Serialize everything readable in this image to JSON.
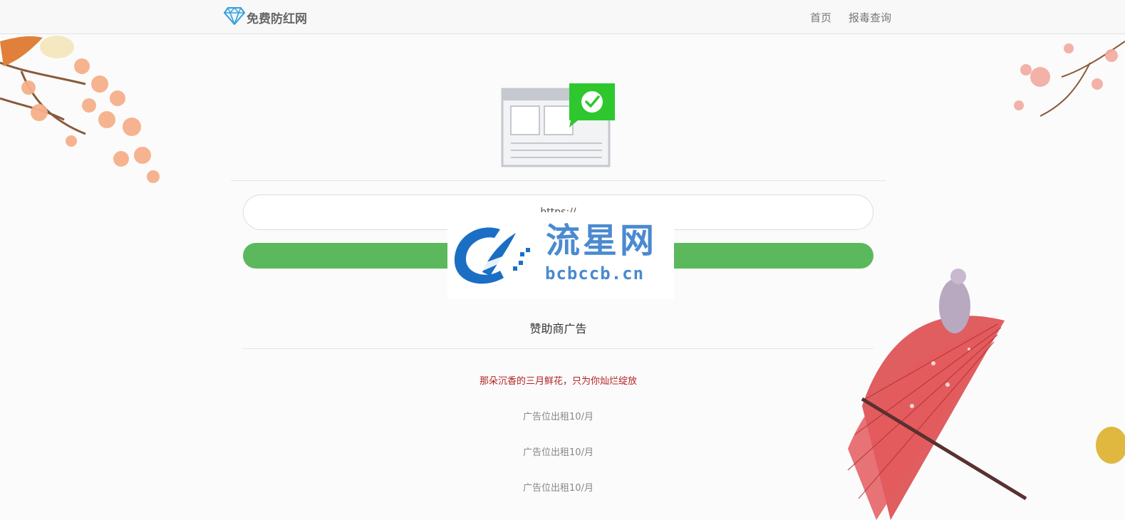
{
  "navbar": {
    "brand": "免费防红网",
    "links": [
      "首页",
      "报毒查询"
    ]
  },
  "form": {
    "url_placeholder": "https://",
    "url_value": "https://",
    "submit_label": ""
  },
  "watermark": {
    "title": "流星网",
    "domain": "bcbccb.cn"
  },
  "sponsor": {
    "title": "赞助商广告",
    "ads": [
      "那朵沉香的三月鲜花，只为你灿烂绽放",
      "广告位出租10/月",
      "广告位出租10/月",
      "广告位出租10/月"
    ]
  },
  "colors": {
    "accent_green": "#5cb85c",
    "ad_red": "#b22222",
    "watermark_blue": "#4a8ad0"
  }
}
